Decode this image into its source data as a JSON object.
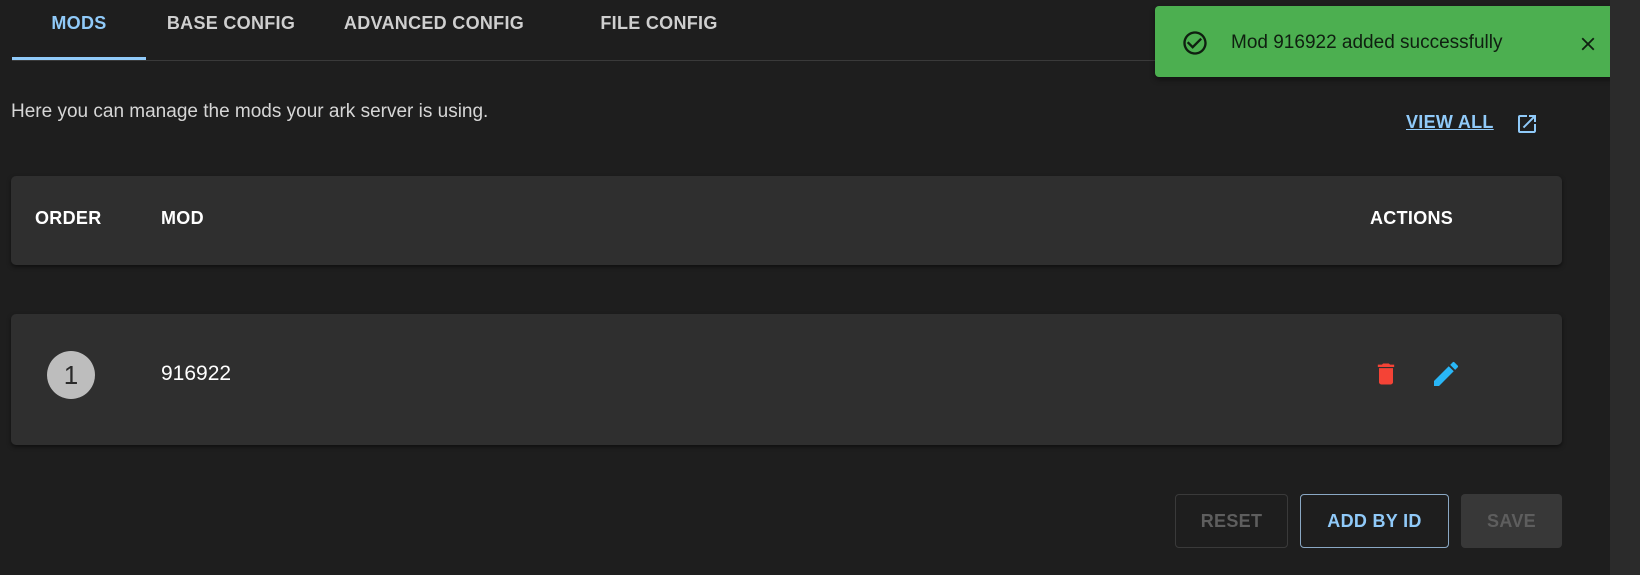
{
  "tabs": [
    {
      "label": "MODS",
      "active": true
    },
    {
      "label": "BASE CONFIG",
      "active": false
    },
    {
      "label": "ADVANCED CONFIG",
      "active": false
    },
    {
      "label": "FILE CONFIG",
      "active": false
    }
  ],
  "intro_text": "Here you can manage the mods your ark server is using.",
  "view_all": {
    "label": "VIEW ALL",
    "icon": "open-in-new-icon"
  },
  "table": {
    "headers": {
      "order": "ORDER",
      "mod": "MOD",
      "actions": "ACTIONS"
    },
    "rows": [
      {
        "order": "1",
        "mod": "916922",
        "actions": [
          "delete-icon",
          "edit-icon"
        ]
      }
    ]
  },
  "buttons": {
    "reset": "RESET",
    "add_by_id": "ADD BY ID",
    "save": "SAVE"
  },
  "toast": {
    "message": "Mod 916922 added successfully",
    "icon": "check-circle-icon",
    "close_icon": "close-icon"
  },
  "colors": {
    "background": "#1e1e1e",
    "card": "#2f2f2f",
    "accent": "#90caf9",
    "success": "#4caf50",
    "danger": "#f44336",
    "edit": "#29b6f6"
  }
}
